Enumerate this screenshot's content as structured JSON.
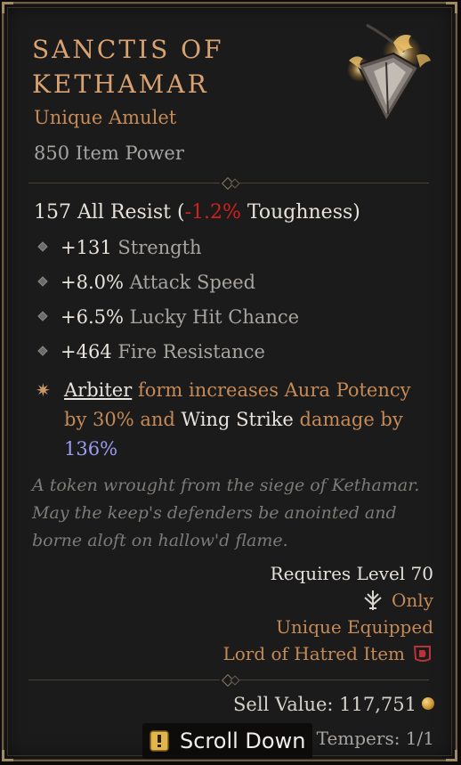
{
  "item": {
    "name_line1": "Sanctis of",
    "name_line2": "Kethamar",
    "rarity": "Unique Amulet",
    "item_power": "850 Item Power",
    "icon": "amulet-icon"
  },
  "resist": {
    "value": "157 All Resist (",
    "toughness": "-1.2%",
    "suffix": " Toughness)"
  },
  "affixes": [
    {
      "value": "+131",
      "stat": " Strength"
    },
    {
      "value": "+8.0%",
      "stat": " Attack Speed"
    },
    {
      "value": "+6.5%",
      "stat": " Lucky Hit Chance"
    },
    {
      "value": "+464",
      "stat": " Fire Resistance"
    }
  ],
  "aspect": {
    "icon": "star-icon",
    "p1": "Arbiter",
    "p2": " form increases Aura Potency by 30% and ",
    "p3": "Wing Strike",
    "p4": " damage by ",
    "p5": "136%"
  },
  "flavor": "A token wrought from the siege of Kethamar. May the keep's defenders be anointed and borne aloft on hallow'd flame.",
  "requirements": {
    "level": "Requires Level 70",
    "class_only": "Only",
    "class_icon": "paladin-class-icon",
    "unique_equipped": "Unique Equipped",
    "expansion": "Lord of Hatred Item",
    "expansion_icon": "d4-expansion-icon"
  },
  "footer": {
    "sell_value": "Sell Value: 117,751",
    "gold_icon": "gold-coin-icon",
    "tempers": "Tempers: 1/1"
  },
  "scroll": {
    "label": "Scroll Down",
    "icon": "scroll-down-icon"
  },
  "colors": {
    "title": "#d9a270",
    "unique": "#c58a55",
    "negative": "#d1211c",
    "percent_highlight": "#9c9cf0",
    "panel_bg": "#1b1b1c",
    "border": "#6d5b44"
  }
}
